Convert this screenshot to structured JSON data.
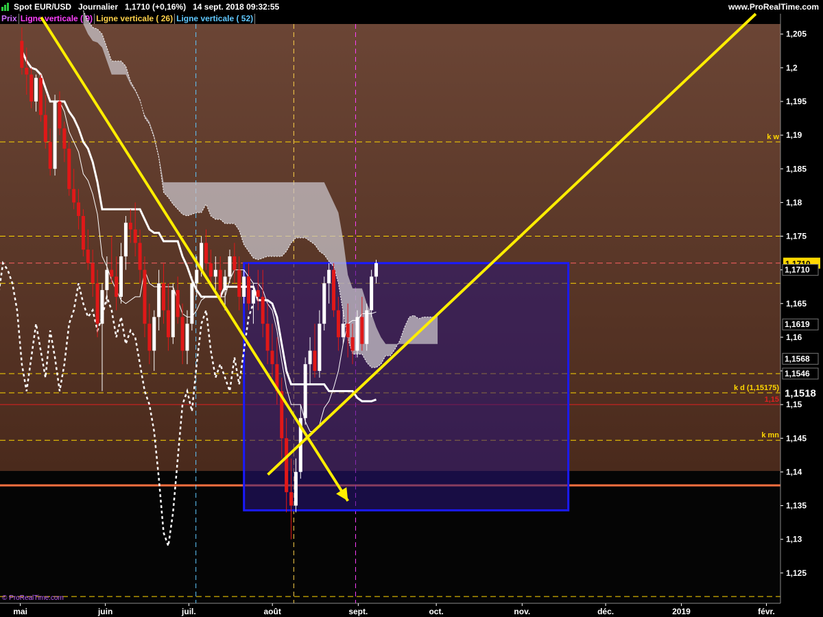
{
  "header": {
    "title": "Spot EUR/USD   Journalier   1,1710 (+0,16%)   14 sept. 2018 09:32:55",
    "site": "www.ProRealTime.com"
  },
  "legend": [
    {
      "label": "Prix",
      "color": "#d070ff"
    },
    {
      "label": "Ligne verticale ( 9)",
      "color": "#ff40ff"
    },
    {
      "label": "Ligne verticale ( 26)",
      "color": "#ffd24a"
    },
    {
      "label": "Ligne verticale ( 52)",
      "color": "#60c8ff"
    }
  ],
  "copyright": "© ProRealTime.com",
  "chart_data": {
    "type": "candlestick",
    "instrument": "Spot EUR/USD",
    "timeframe": "Journalier",
    "ylim": [
      1.1205,
      1.2065
    ],
    "yticks": [
      "1,205",
      "1,2",
      "1,195",
      "1,19",
      "1,185",
      "1,18",
      "1,175",
      "1,17",
      "1,165",
      "1,16",
      "1,155",
      "1,15",
      "1,145",
      "1,14",
      "1,135",
      "1,13",
      "1,125"
    ],
    "xticks": [
      "mai",
      "juin",
      "juil.",
      "août",
      "sept.",
      "oct.",
      "nov.",
      "déc.",
      "2019",
      "févr."
    ],
    "price_labels": [
      {
        "text": "1,1710",
        "value": 1.171,
        "style": "current"
      },
      {
        "text": "1,1710",
        "value": 1.17,
        "style": "plain"
      },
      {
        "text": "1,1619",
        "value": 1.1619,
        "style": "plain"
      },
      {
        "text": "1,1568",
        "value": 1.1568,
        "style": "plain"
      },
      {
        "text": "1,1546",
        "value": 1.1546,
        "style": "plain"
      },
      {
        "text": "1,1518",
        "value": 1.1518,
        "style": "big"
      }
    ],
    "levels": [
      {
        "label": "k w",
        "value": 1.189,
        "color": "#ffd700",
        "dash": true
      },
      {
        "label": "",
        "value": 1.175,
        "color": "#ffd700",
        "dash": true
      },
      {
        "label": "",
        "value": 1.171,
        "color": "#ff6060",
        "dash": true
      },
      {
        "label": "",
        "value": 1.168,
        "color": "#ffd700",
        "dash": true
      },
      {
        "label": "",
        "value": 1.1546,
        "color": "#ffd700",
        "dash": true
      },
      {
        "label": "k d (1,15175)",
        "value": 1.15175,
        "color": "#ffd700",
        "dash": true
      },
      {
        "label": "1,15",
        "value": 1.15,
        "color": "#e02020",
        "dash": false
      },
      {
        "label": "k mn",
        "value": 1.1447,
        "color": "#ffd700",
        "dash": true
      },
      {
        "label": "",
        "value": 1.138,
        "color": "#ff7040",
        "dash": false
      },
      {
        "label": "",
        "value": 1.1215,
        "color": "#ffd700",
        "dash": true
      }
    ],
    "vertical_lines": [
      {
        "color": "#60c8ff",
        "x_frac": 0.251
      },
      {
        "color": "#ffd24a",
        "x_frac": 0.3764
      },
      {
        "color": "#ff40ff",
        "x_frac": 0.4556
      }
    ],
    "rectangle": {
      "x_from": 0.3126,
      "x_to": 0.7282,
      "y_top": 1.171,
      "y_bottom": 1.1343
    },
    "trendlines": [
      {
        "x1": 0.0528,
        "y1": 1.2075,
        "x2": 0.4458,
        "y2": 1.1357
      },
      {
        "x1": 0.3432,
        "y1": 1.1396,
        "x2": 0.9683,
        "y2": 1.208
      }
    ],
    "candles": [
      {
        "o": 1.204,
        "h": 1.206,
        "l": 1.199,
        "c": 1.2
      },
      {
        "o": 1.2,
        "h": 1.203,
        "l": 1.196,
        "c": 1.199
      },
      {
        "o": 1.199,
        "h": 1.2,
        "l": 1.194,
        "c": 1.195
      },
      {
        "o": 1.195,
        "h": 1.199,
        "l": 1.1935,
        "c": 1.1985
      },
      {
        "o": 1.1985,
        "h": 1.199,
        "l": 1.192,
        "c": 1.193
      },
      {
        "o": 1.193,
        "h": 1.196,
        "l": 1.188,
        "c": 1.189
      },
      {
        "o": 1.189,
        "h": 1.191,
        "l": 1.184,
        "c": 1.185
      },
      {
        "o": 1.185,
        "h": 1.196,
        "l": 1.184,
        "c": 1.195
      },
      {
        "o": 1.195,
        "h": 1.1965,
        "l": 1.19,
        "c": 1.191
      },
      {
        "o": 1.191,
        "h": 1.192,
        "l": 1.186,
        "c": 1.188
      },
      {
        "o": 1.188,
        "h": 1.189,
        "l": 1.181,
        "c": 1.182
      },
      {
        "o": 1.182,
        "h": 1.185,
        "l": 1.179,
        "c": 1.18
      },
      {
        "o": 1.18,
        "h": 1.182,
        "l": 1.176,
        "c": 1.178
      },
      {
        "o": 1.178,
        "h": 1.179,
        "l": 1.172,
        "c": 1.173
      },
      {
        "o": 1.173,
        "h": 1.176,
        "l": 1.17,
        "c": 1.171
      },
      {
        "o": 1.171,
        "h": 1.173,
        "l": 1.166,
        "c": 1.168
      },
      {
        "o": 1.168,
        "h": 1.17,
        "l": 1.16,
        "c": 1.162
      },
      {
        "o": 1.162,
        "h": 1.168,
        "l": 1.152,
        "c": 1.167
      },
      {
        "o": 1.167,
        "h": 1.172,
        "l": 1.165,
        "c": 1.17
      },
      {
        "o": 1.17,
        "h": 1.175,
        "l": 1.168,
        "c": 1.169
      },
      {
        "o": 1.169,
        "h": 1.172,
        "l": 1.164,
        "c": 1.166
      },
      {
        "o": 1.166,
        "h": 1.174,
        "l": 1.165,
        "c": 1.172
      },
      {
        "o": 1.172,
        "h": 1.178,
        "l": 1.17,
        "c": 1.177
      },
      {
        "o": 1.177,
        "h": 1.179,
        "l": 1.174,
        "c": 1.176
      },
      {
        "o": 1.176,
        "h": 1.18,
        "l": 1.172,
        "c": 1.174
      },
      {
        "o": 1.174,
        "h": 1.176,
        "l": 1.168,
        "c": 1.17
      },
      {
        "o": 1.17,
        "h": 1.172,
        "l": 1.16,
        "c": 1.162
      },
      {
        "o": 1.162,
        "h": 1.165,
        "l": 1.156,
        "c": 1.158
      },
      {
        "o": 1.158,
        "h": 1.164,
        "l": 1.155,
        "c": 1.163
      },
      {
        "o": 1.163,
        "h": 1.17,
        "l": 1.161,
        "c": 1.168
      },
      {
        "o": 1.168,
        "h": 1.171,
        "l": 1.162,
        "c": 1.164
      },
      {
        "o": 1.164,
        "h": 1.168,
        "l": 1.158,
        "c": 1.16
      },
      {
        "o": 1.16,
        "h": 1.168,
        "l": 1.159,
        "c": 1.167
      },
      {
        "o": 1.167,
        "h": 1.169,
        "l": 1.162,
        "c": 1.163
      },
      {
        "o": 1.163,
        "h": 1.165,
        "l": 1.156,
        "c": 1.158
      },
      {
        "o": 1.158,
        "h": 1.164,
        "l": 1.156,
        "c": 1.162
      },
      {
        "o": 1.162,
        "h": 1.169,
        "l": 1.161,
        "c": 1.168
      },
      {
        "o": 1.168,
        "h": 1.172,
        "l": 1.166,
        "c": 1.17
      },
      {
        "o": 1.17,
        "h": 1.175,
        "l": 1.169,
        "c": 1.174
      },
      {
        "o": 1.174,
        "h": 1.176,
        "l": 1.17,
        "c": 1.171
      },
      {
        "o": 1.171,
        "h": 1.173,
        "l": 1.168,
        "c": 1.169
      },
      {
        "o": 1.169,
        "h": 1.172,
        "l": 1.167,
        "c": 1.17
      },
      {
        "o": 1.17,
        "h": 1.172,
        "l": 1.165,
        "c": 1.167
      },
      {
        "o": 1.167,
        "h": 1.17,
        "l": 1.164,
        "c": 1.169
      },
      {
        "o": 1.169,
        "h": 1.173,
        "l": 1.168,
        "c": 1.172
      },
      {
        "o": 1.172,
        "h": 1.174,
        "l": 1.168,
        "c": 1.17
      },
      {
        "o": 1.17,
        "h": 1.172,
        "l": 1.164,
        "c": 1.166
      },
      {
        "o": 1.166,
        "h": 1.17,
        "l": 1.165,
        "c": 1.169
      },
      {
        "o": 1.169,
        "h": 1.171,
        "l": 1.164,
        "c": 1.165
      },
      {
        "o": 1.165,
        "h": 1.168,
        "l": 1.162,
        "c": 1.167
      },
      {
        "o": 1.167,
        "h": 1.17,
        "l": 1.164,
        "c": 1.166
      },
      {
        "o": 1.166,
        "h": 1.17,
        "l": 1.16,
        "c": 1.162
      },
      {
        "o": 1.162,
        "h": 1.165,
        "l": 1.156,
        "c": 1.158
      },
      {
        "o": 1.158,
        "h": 1.162,
        "l": 1.154,
        "c": 1.156
      },
      {
        "o": 1.156,
        "h": 1.16,
        "l": 1.15,
        "c": 1.152
      },
      {
        "o": 1.152,
        "h": 1.154,
        "l": 1.142,
        "c": 1.145
      },
      {
        "o": 1.145,
        "h": 1.148,
        "l": 1.134,
        "c": 1.137
      },
      {
        "o": 1.137,
        "h": 1.142,
        "l": 1.13,
        "c": 1.135
      },
      {
        "o": 1.135,
        "h": 1.142,
        "l": 1.134,
        "c": 1.14
      },
      {
        "o": 1.14,
        "h": 1.15,
        "l": 1.139,
        "c": 1.148
      },
      {
        "o": 1.148,
        "h": 1.157,
        "l": 1.147,
        "c": 1.156
      },
      {
        "o": 1.156,
        "h": 1.16,
        "l": 1.153,
        "c": 1.158
      },
      {
        "o": 1.158,
        "h": 1.162,
        "l": 1.154,
        "c": 1.155
      },
      {
        "o": 1.155,
        "h": 1.164,
        "l": 1.154,
        "c": 1.162
      },
      {
        "o": 1.162,
        "h": 1.169,
        "l": 1.161,
        "c": 1.168
      },
      {
        "o": 1.168,
        "h": 1.171,
        "l": 1.165,
        "c": 1.17
      },
      {
        "o": 1.17,
        "h": 1.171,
        "l": 1.163,
        "c": 1.164
      },
      {
        "o": 1.164,
        "h": 1.166,
        "l": 1.158,
        "c": 1.16
      },
      {
        "o": 1.16,
        "h": 1.164,
        "l": 1.159,
        "c": 1.162
      },
      {
        "o": 1.162,
        "h": 1.165,
        "l": 1.157,
        "c": 1.16
      },
      {
        "o": 1.16,
        "h": 1.162,
        "l": 1.156,
        "c": 1.158
      },
      {
        "o": 1.158,
        "h": 1.164,
        "l": 1.157,
        "c": 1.163
      },
      {
        "o": 1.163,
        "h": 1.166,
        "l": 1.158,
        "c": 1.159
      },
      {
        "o": 1.159,
        "h": 1.165,
        "l": 1.158,
        "c": 1.164
      },
      {
        "o": 1.164,
        "h": 1.17,
        "l": 1.163,
        "c": 1.169
      },
      {
        "o": 1.169,
        "h": 1.1715,
        "l": 1.168,
        "c": 1.171
      }
    ]
  }
}
